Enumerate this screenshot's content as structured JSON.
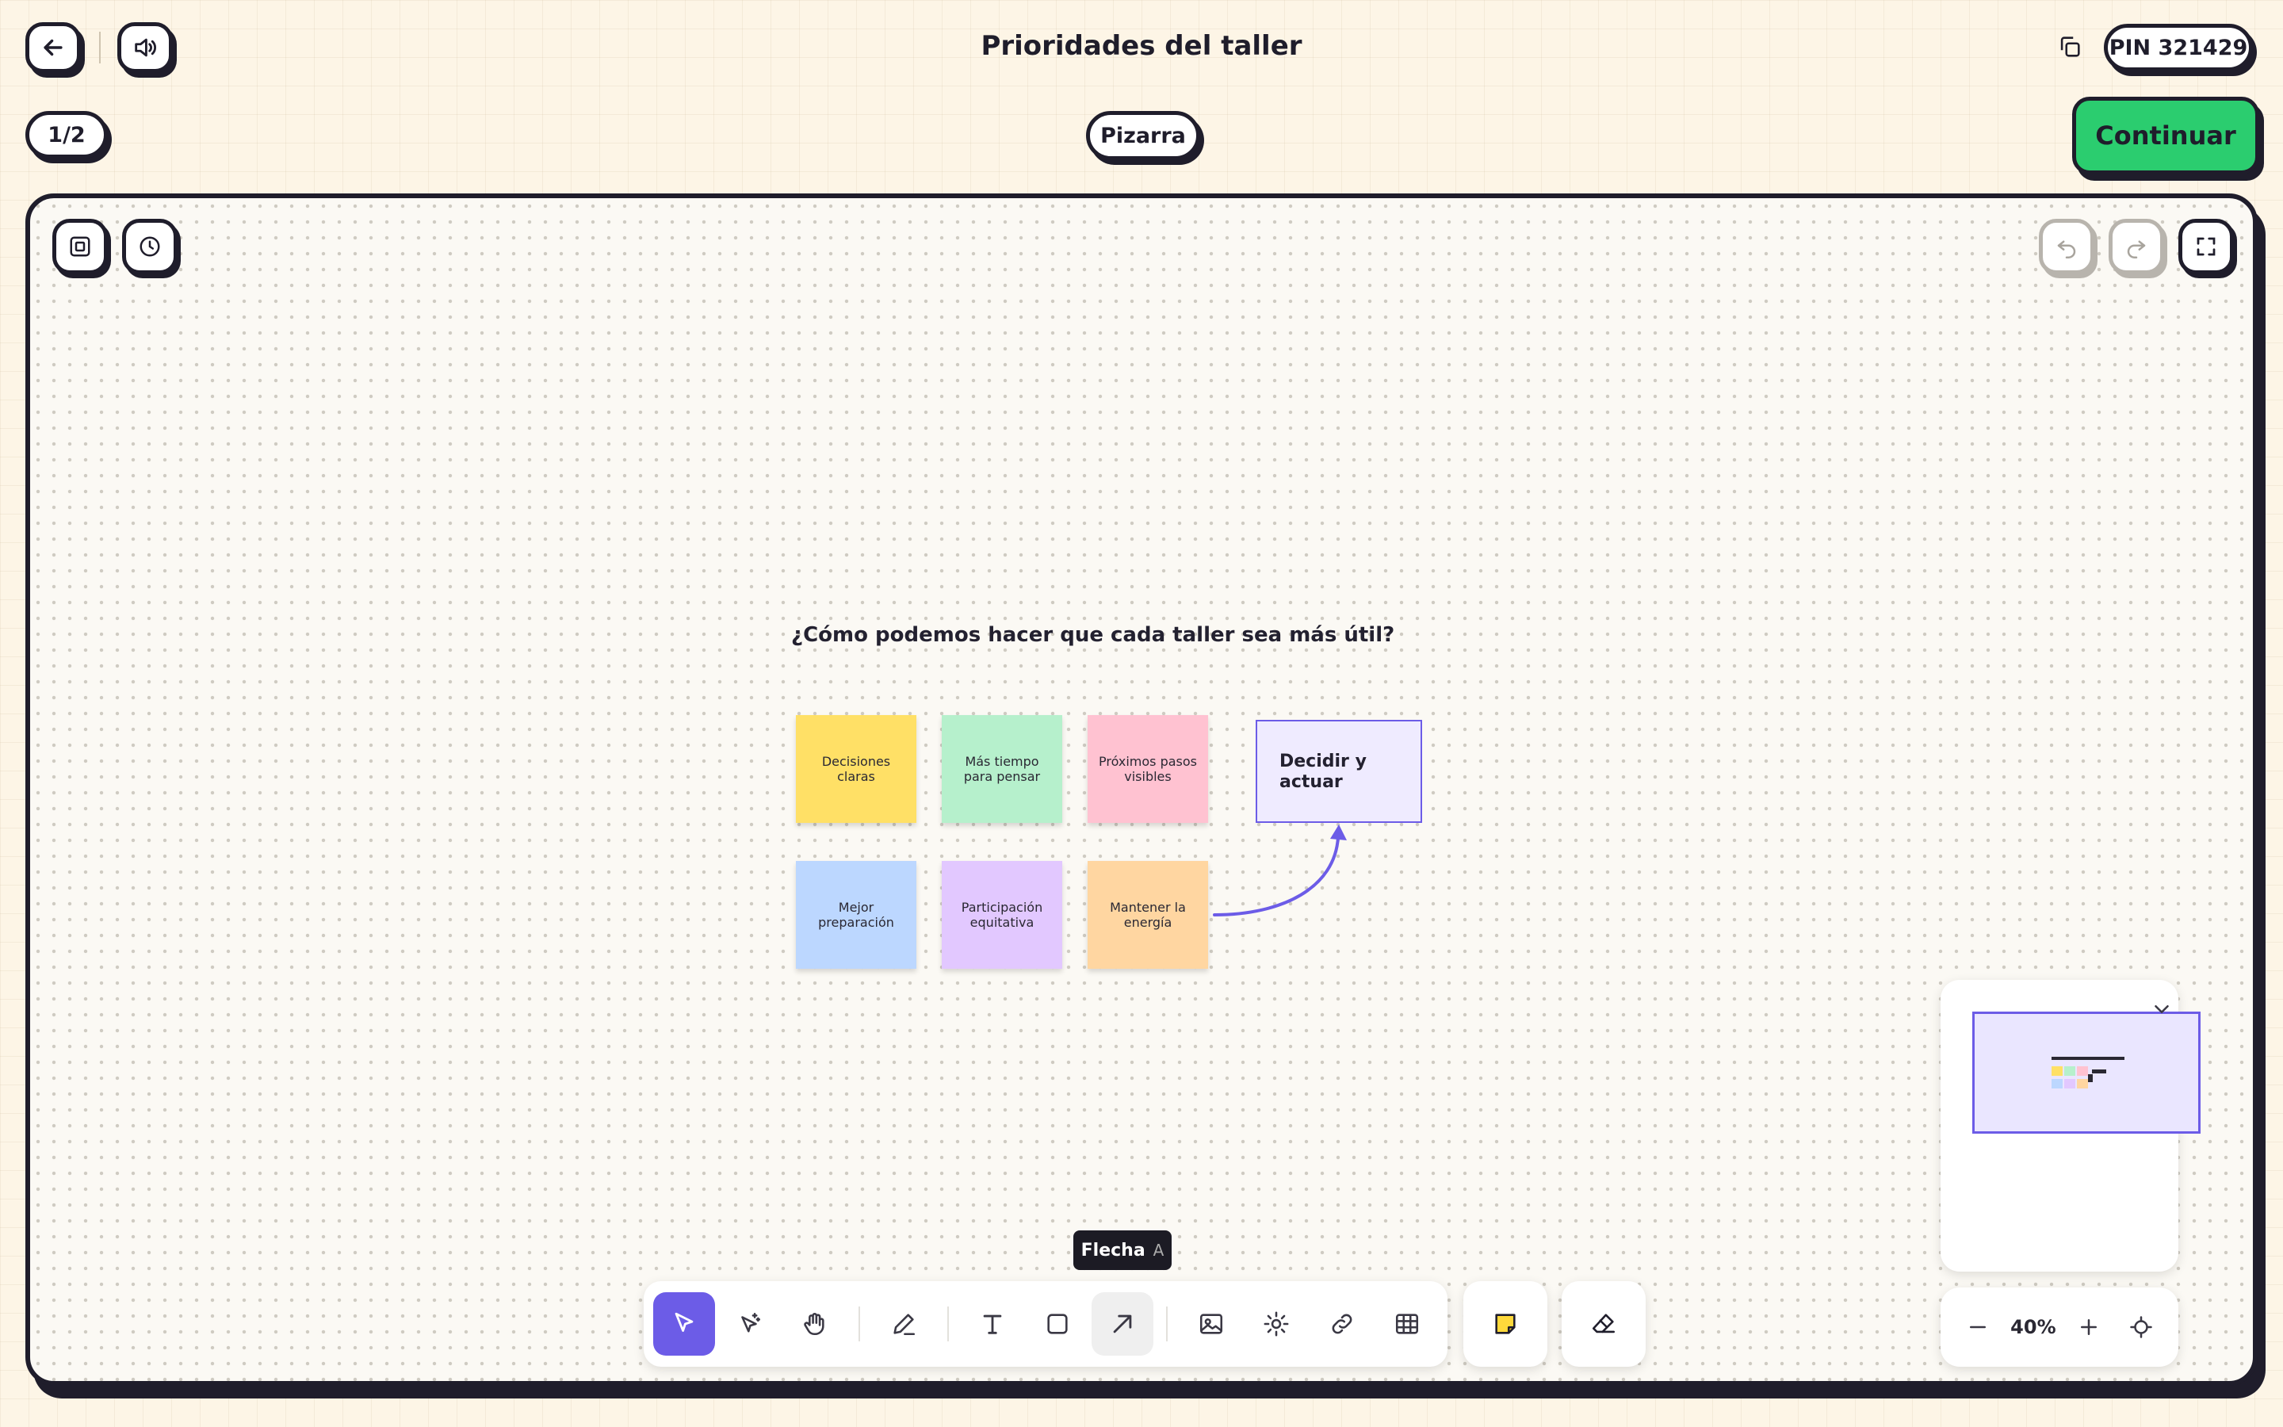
{
  "header": {
    "title": "Prioridades del taller",
    "pin_label": "PIN 321429",
    "page_counter": "1/2",
    "board_tab": "Pizarra",
    "continue_label": "Continuar"
  },
  "board": {
    "prompt": "¿Cómo podemos hacer que cada taller sea más útil?",
    "stickies": [
      {
        "text": "Decisiones claras",
        "color": "#ffe066"
      },
      {
        "text": "Más tiempo para pensar",
        "color": "#b6f0cc"
      },
      {
        "text": "Próximos pasos visibles",
        "color": "#ffc2d1"
      },
      {
        "text": "Mejor preparación",
        "color": "#bcd7ff"
      },
      {
        "text": "Participación equitativa",
        "color": "#e2c8ff"
      },
      {
        "text": "Mantener la energía",
        "color": "#ffd6a1"
      }
    ],
    "target_box": "Decidir y actuar",
    "arrow_color": "#6c5ce7"
  },
  "tooltip": {
    "label": "Flecha",
    "shortcut": "A"
  },
  "toolbar": {
    "tools": [
      "select",
      "laser-pointer",
      "hand",
      "pen",
      "text",
      "rectangle",
      "arrow",
      "image",
      "effects",
      "link",
      "table",
      "sticky-note",
      "eraser"
    ],
    "active_tool": "select",
    "hovered_tool": "arrow"
  },
  "zoom": {
    "level": "40%"
  },
  "colors": {
    "accent": "#6c5ce7",
    "continue": "#2bcd6f",
    "ink": "#1f1d2b",
    "page_bg": "#fdf5e6"
  }
}
